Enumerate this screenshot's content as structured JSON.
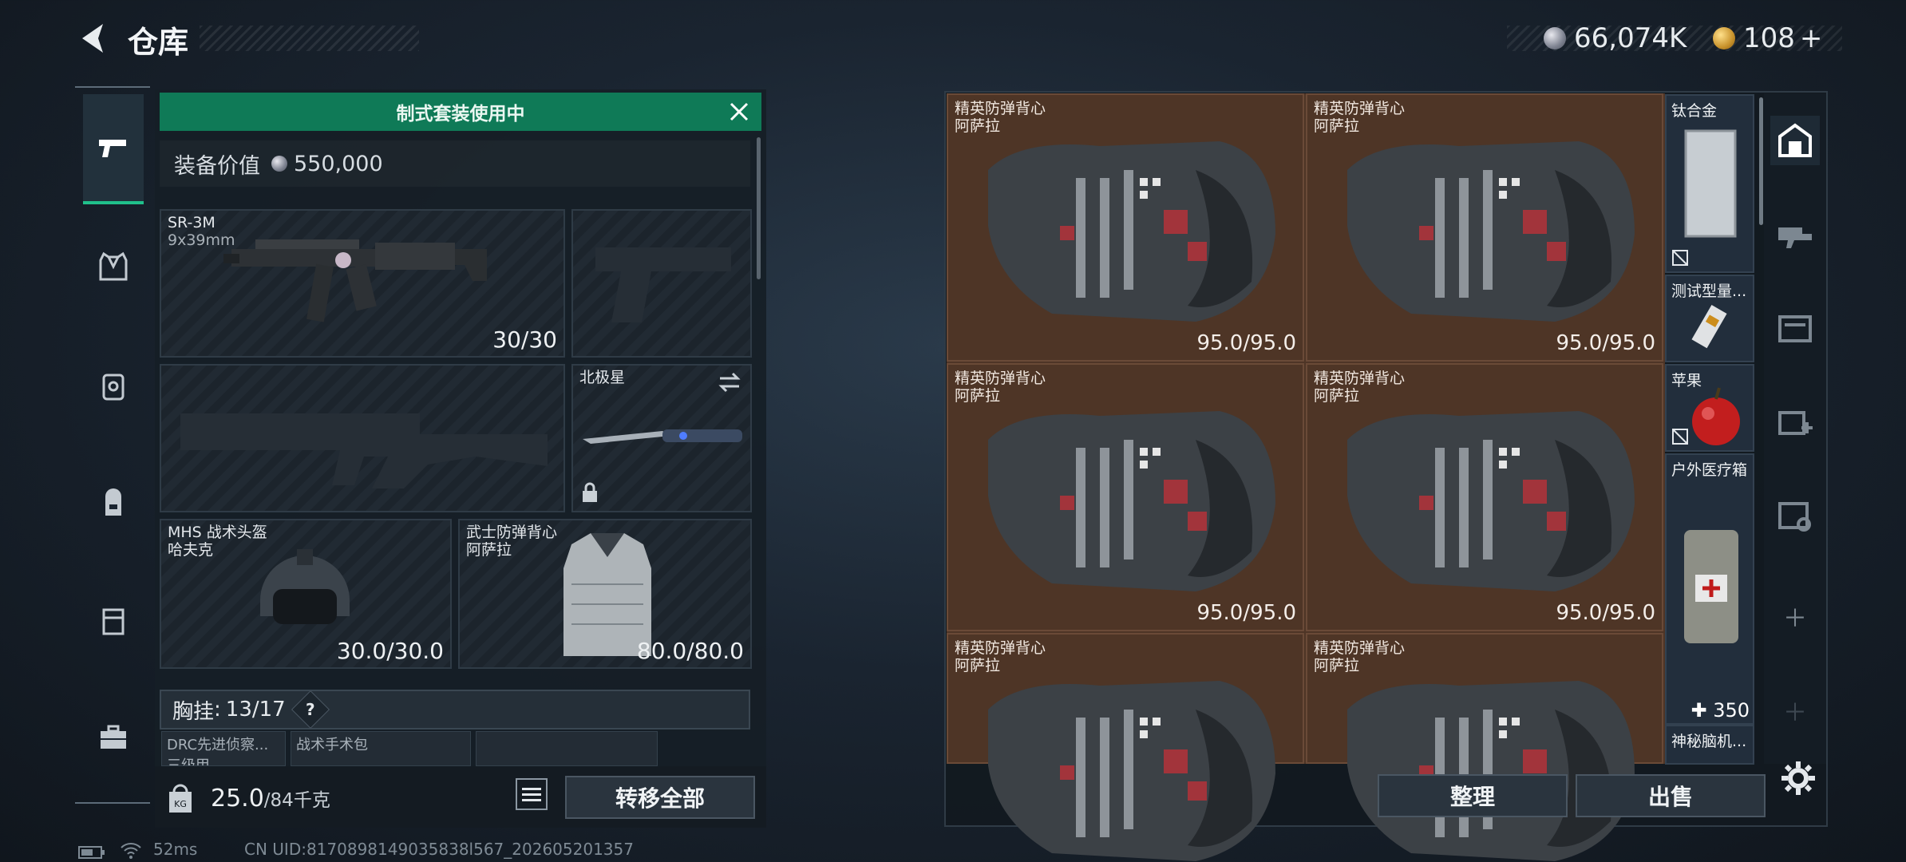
{
  "header": {
    "title": "仓库"
  },
  "currency": {
    "silver": "66,074K",
    "gold": "108",
    "gold_add": "+"
  },
  "banner": {
    "text": "制式套装使用中"
  },
  "equipment_value": {
    "label": "装备价值",
    "value": "550,000"
  },
  "slots": {
    "primary": {
      "name": "SR-3M",
      "caliber": "9x39mm",
      "ammo": "30/30"
    },
    "melee": {
      "name": "北极星"
    },
    "helmet": {
      "name": "MHS 战术头盔",
      "brand": "哈夫克",
      "durability": "30.0/30.0"
    },
    "armor": {
      "name": "武士防弹背心",
      "brand": "阿萨拉",
      "durability": "80.0/80.0"
    }
  },
  "chest_rig": {
    "label": "胸挂",
    "sep": ":",
    "value": "13/17",
    "help": "?"
  },
  "mini_items": [
    "DRC先进侦察...",
    "战术手术包",
    ""
  ],
  "mini_sub": "三级甲",
  "weight": {
    "value": "25.0",
    "max": "/84千克",
    "icon_text": "KG"
  },
  "buttons": {
    "transfer_all": "转移全部",
    "organize": "整理",
    "sell": "出售"
  },
  "storage_items": [
    {
      "name": "精英防弹背心",
      "brand": "阿萨拉",
      "durability": "95.0/95.0"
    },
    {
      "name": "精英防弹背心",
      "brand": "阿萨拉",
      "durability": "95.0/95.0"
    },
    {
      "name": "精英防弹背心",
      "brand": "阿萨拉",
      "durability": "95.0/95.0"
    },
    {
      "name": "精英防弹背心",
      "brand": "阿萨拉",
      "durability": "95.0/95.0"
    },
    {
      "name": "精英防弹背心",
      "brand": "阿萨拉",
      "durability": ""
    },
    {
      "name": "精英防弹背心",
      "brand": "阿萨拉",
      "durability": ""
    }
  ],
  "side_items": [
    {
      "name": "钛合金"
    },
    {
      "name": "测试型量..."
    },
    {
      "name": "苹果"
    },
    {
      "name": "户外医疗箱",
      "count": "350"
    },
    {
      "name": "神秘脑机..."
    }
  ],
  "status": {
    "ping": "52ms",
    "uid": "CN UID:8170898149035838l567_202605201357"
  },
  "colors": {
    "banner": "#0f7a57",
    "active_tab": "#20c08b",
    "grid_bg": "#4e3526"
  }
}
